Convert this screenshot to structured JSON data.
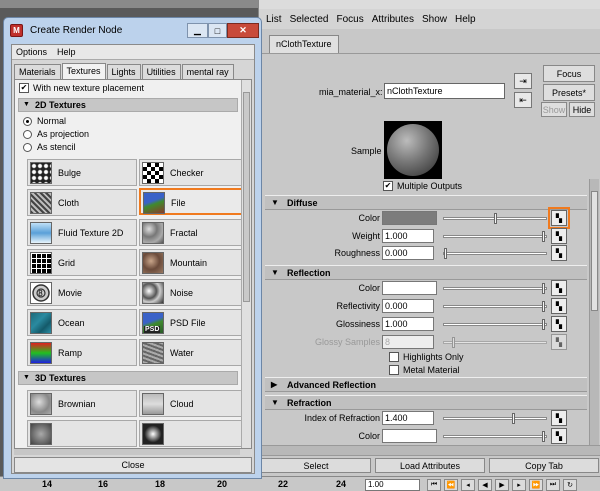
{
  "main_window": {
    "menu": [
      "List",
      "Selected",
      "Focus",
      "Attributes",
      "Show",
      "Help"
    ],
    "tab": "nClothTexture",
    "node_field_label": "mia_material_x:",
    "node_field_value": "nClothTexture",
    "buttons": {
      "focus": "Focus",
      "presets": "Presets*",
      "show": "Show",
      "hide": "Hide"
    },
    "sample_label": "Sample",
    "multiple_outputs": "Multiple Outputs",
    "sections": {
      "diffuse": "Diffuse",
      "reflection": "Reflection",
      "advanced_reflection": "Advanced Reflection",
      "refraction": "Refraction"
    },
    "diffuse": {
      "color_label": "Color",
      "color_value": "#7c7c7c",
      "weight_label": "Weight",
      "weight_value": "1.000",
      "roughness_label": "Roughness",
      "roughness_value": "0.000"
    },
    "reflection": {
      "color_label": "Color",
      "color_value": "#ffffff",
      "reflectivity_label": "Reflectivity",
      "reflectivity_value": "0.000",
      "glossiness_label": "Glossiness",
      "glossiness_value": "1.000",
      "glossy_samples_label": "Glossy Samples",
      "glossy_samples_value": "8",
      "highlights_only": "Highlights Only",
      "metal_material": "Metal Material"
    },
    "refraction": {
      "ior_label": "Index of Refraction",
      "ior_value": "1.400",
      "color_label": "Color"
    },
    "footer": {
      "select": "Select",
      "load_attributes": "Load Attributes",
      "copy_tab": "Copy Tab"
    },
    "timeline": {
      "ticks": [
        "14",
        "16",
        "18",
        "20",
        "22",
        "24"
      ],
      "time_value": "1.00"
    }
  },
  "dialog": {
    "title": "Create Render Node",
    "menu": [
      "Options",
      "Help"
    ],
    "tabs": [
      "Materials",
      "Textures",
      "Lights",
      "Utilities",
      "mental ray"
    ],
    "active_tab": "Textures",
    "texture_placement": "With new texture placement",
    "section_2d": "2D Textures",
    "section_3d": "3D Textures",
    "radio_options": [
      "Normal",
      "As projection",
      "As stencil"
    ],
    "nodes_2d": [
      {
        "label": "Bulge",
        "icon": "bulge-texture-icon"
      },
      {
        "label": "Checker",
        "icon": "checker-texture-icon"
      },
      {
        "label": "Cloth",
        "icon": "cloth-texture-icon"
      },
      {
        "label": "File",
        "icon": "file-texture-icon"
      },
      {
        "label": "Fluid Texture 2D",
        "icon": "fluid-texture-icon"
      },
      {
        "label": "Fractal",
        "icon": "fractal-texture-icon"
      },
      {
        "label": "Grid",
        "icon": "grid-texture-icon"
      },
      {
        "label": "Mountain",
        "icon": "mountain-texture-icon"
      },
      {
        "label": "Movie",
        "icon": "movie-texture-icon"
      },
      {
        "label": "Noise",
        "icon": "noise-texture-icon"
      },
      {
        "label": "Ocean",
        "icon": "ocean-texture-icon"
      },
      {
        "label": "PSD File",
        "icon": "psd-file-texture-icon"
      },
      {
        "label": "Ramp",
        "icon": "ramp-texture-icon"
      },
      {
        "label": "Water",
        "icon": "water-texture-icon"
      }
    ],
    "nodes_3d": [
      {
        "label": "Brownian",
        "icon": "brownian-texture-icon"
      },
      {
        "label": "Cloud",
        "icon": "cloud-texture-icon"
      }
    ],
    "psd_thumb_text": "PSD",
    "close_label": "Close"
  },
  "colors": {
    "highlight": "#f07a1e",
    "dialog_frame": "#bcd2ec"
  }
}
